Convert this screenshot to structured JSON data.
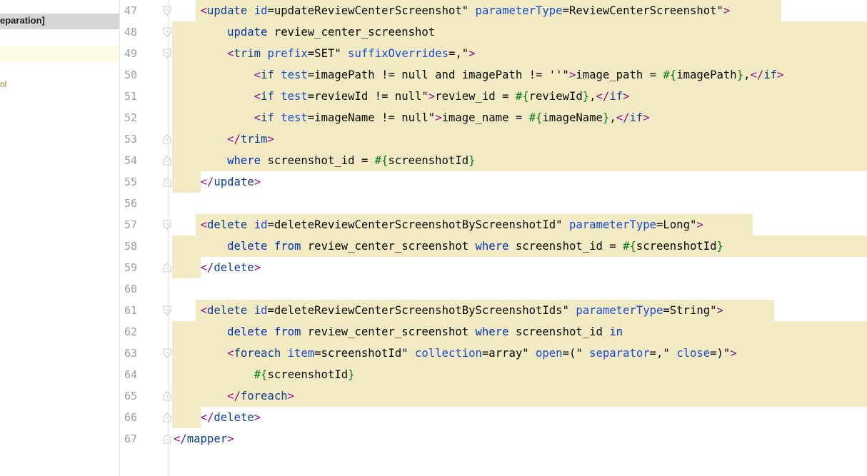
{
  "project_panel": {
    "selected_label": "eparation]",
    "xml_label": "nl"
  },
  "editor": {
    "lines": [
      {
        "n": "47",
        "code": "    <update id=\"updateReviewCenterScreenshot\" parameterType=\"ReviewCenterScreenshot\">"
      },
      {
        "n": "48",
        "code": "        update review_center_screenshot"
      },
      {
        "n": "49",
        "code": "        <trim prefix=\"SET\" suffixOverrides=\",\">"
      },
      {
        "n": "50",
        "code": "            <if test=\"imagePath != null and imagePath != ''\">image_path = #{imagePath},</if>"
      },
      {
        "n": "51",
        "code": "            <if test=\"reviewId != null\">review_id = #{reviewId},</if>"
      },
      {
        "n": "52",
        "code": "            <if test=\"imageName != null\">image_name = #{imageName},</if>"
      },
      {
        "n": "53",
        "code": "        </trim>"
      },
      {
        "n": "54",
        "code": "        where screenshot_id = #{screenshotId}"
      },
      {
        "n": "55",
        "code": "    </update>"
      },
      {
        "n": "56",
        "code": ""
      },
      {
        "n": "57",
        "code": "    <delete id=\"deleteReviewCenterScreenshotByScreenshotId\" parameterType=\"Long\">"
      },
      {
        "n": "58",
        "code": "        delete from review_center_screenshot where screenshot_id = #{screenshotId}"
      },
      {
        "n": "59",
        "code": "    </delete>"
      },
      {
        "n": "60",
        "code": ""
      },
      {
        "n": "61",
        "code": "    <delete id=\"deleteReviewCenterScreenshotByScreenshotIds\" parameterType=\"String\">"
      },
      {
        "n": "62",
        "code": "        delete from review_center_screenshot where screenshot_id in"
      },
      {
        "n": "63",
        "code": "        <foreach item=\"screenshotId\" collection=\"array\" open=\"(\" separator=\",\" close=\")\">"
      },
      {
        "n": "64",
        "code": "            #{screenshotId}"
      },
      {
        "n": "65",
        "code": "        </foreach>"
      },
      {
        "n": "66",
        "code": "    </delete>"
      },
      {
        "n": "67",
        "code": "</mapper>"
      }
    ]
  },
  "colors": {
    "highlight": "#f2eac3",
    "tag": "#0b3d91",
    "attribute": "#174ad4",
    "string": "#067d17",
    "line_number": "#9d9d9d"
  }
}
